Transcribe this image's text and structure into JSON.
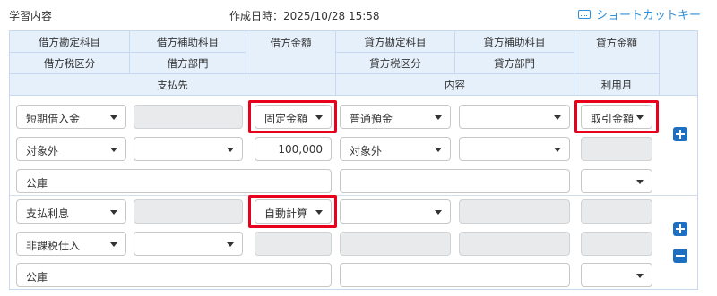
{
  "header": {
    "title": "学習内容",
    "created": "作成日時：2025/10/28 15:58",
    "shortcut": "ショートカットキー"
  },
  "table_headers": {
    "row1": [
      "借方勘定科目",
      "借方補助科目",
      "借方金額",
      "貸方勘定科目",
      "貸方補助科目",
      "貸方金額"
    ],
    "row2": [
      "借方税区分",
      "借方部門",
      "",
      "貸方税区分",
      "貸方部門",
      ""
    ],
    "row3": [
      "支払先",
      "内容",
      "利用月"
    ]
  },
  "entry1": {
    "debit_account": "短期借入金",
    "debit_amount_mode": "固定金額",
    "credit_account": "普通預金",
    "credit_amount_mode": "取引金額",
    "debit_tax": "対象外",
    "debit_amount": "100,000",
    "credit_tax": "対象外",
    "payee": "公庫"
  },
  "entry2": {
    "debit_account": "支払利息",
    "debit_amount_mode": "自動計算",
    "debit_tax": "非課税仕入",
    "payee": "公庫"
  },
  "colors": {
    "accent": "#1e6fc0",
    "highlight": "#e8001c",
    "header_bg": "#e6f0fb",
    "link": "#2f8fd8"
  }
}
